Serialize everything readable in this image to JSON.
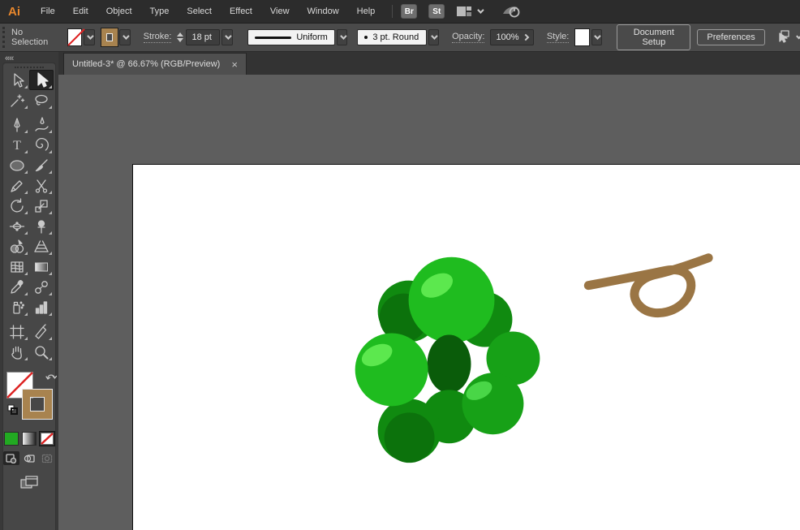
{
  "app": {
    "logo": "Ai",
    "menus": [
      "File",
      "Edit",
      "Object",
      "Type",
      "Select",
      "Effect",
      "View",
      "Window",
      "Help"
    ],
    "bridge_button": "Br",
    "stock_button": "St"
  },
  "control_bar": {
    "selection_status": "No Selection",
    "stroke_label": "Stroke:",
    "stroke_weight": "18 pt",
    "profile_value": "Uniform",
    "brush_value": "3 pt. Round",
    "opacity_label": "Opacity:",
    "opacity_value": "100%",
    "style_label": "Style:",
    "document_setup_label": "Document Setup",
    "preferences_label": "Preferences"
  },
  "document_tab": {
    "title": "Untitled-3* @ 66.67% (RGB/Preview)",
    "close_glyph": "×"
  },
  "toolbar": {
    "collapse_glyph": "««",
    "type_glyph": "T",
    "selected_tool": "selection",
    "tools": [
      "direct-selection",
      "selection",
      "magic-wand",
      "lasso",
      "pen",
      "curvature",
      "type",
      "spiral",
      "ellipse",
      "paintbrush",
      "pencil",
      "scissors",
      "rotate",
      "scale",
      "width",
      "puppet-warp",
      "shape-builder",
      "perspective-grid",
      "mesh",
      "gradient",
      "eyedropper",
      "blend",
      "symbol-sprayer",
      "column-graph",
      "artboard",
      "slice",
      "hand",
      "zoom"
    ],
    "fill_value": "none",
    "stroke_value": "#a8834f",
    "last_color": "#22a922"
  },
  "artwork": {
    "colors": {
      "bright": "#1fbc1f",
      "mid": "#17a117",
      "dark": "#108a10",
      "darker": "#0c720c",
      "core": "#0a5c0a",
      "highlight": "#5ce84e",
      "highlight2": "#49d647",
      "stem": "#9a7544"
    }
  }
}
